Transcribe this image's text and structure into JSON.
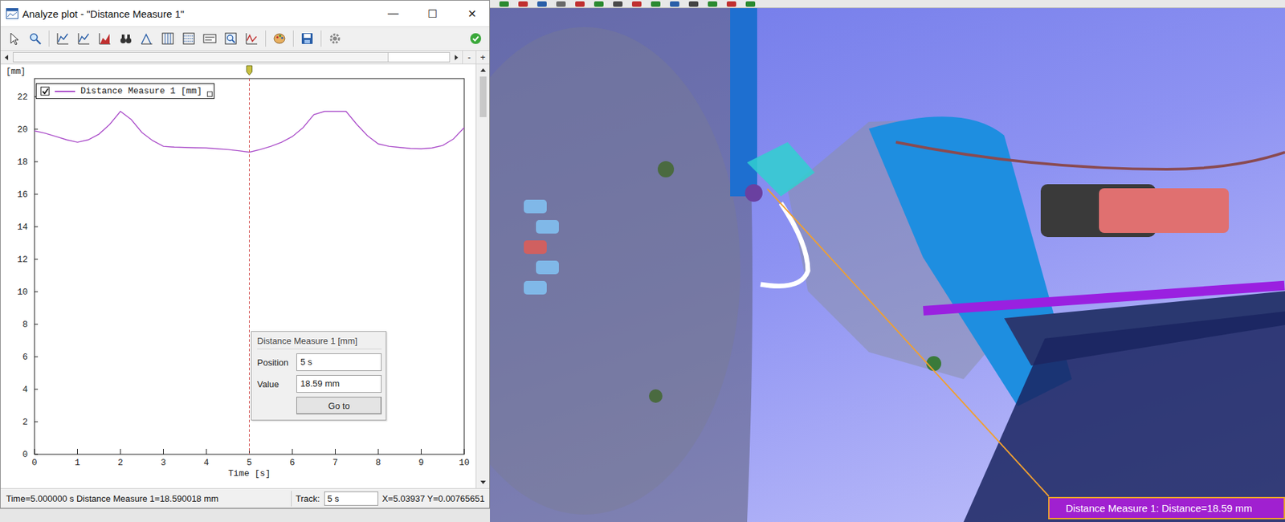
{
  "window": {
    "title": "Analyze plot - \"Distance Measure 1\"",
    "controls": [
      "—",
      "☐",
      "✕"
    ]
  },
  "scroll": {
    "zoom_out": "-",
    "zoom_in": "+"
  },
  "chart": {
    "y_unit": "[mm]",
    "y_ticks": [
      "0",
      "2",
      "4",
      "6",
      "8",
      "10",
      "12",
      "14",
      "16",
      "18",
      "20",
      "22"
    ],
    "x_ticks": [
      "0",
      "1",
      "2",
      "3",
      "4",
      "5",
      "6",
      "7",
      "8",
      "9",
      "10"
    ],
    "x_label": "Time [s]",
    "legend": {
      "label": "Distance Measure 1 [mm]",
      "checked": true
    },
    "cursor_time": 5,
    "series": [
      {
        "name": "Distance Measure 1",
        "color": "#a848c8",
        "values": [
          19.9,
          19.75,
          19.55,
          19.35,
          19.2,
          19.35,
          19.7,
          20.3,
          21.1,
          20.6,
          19.8,
          19.3,
          18.95,
          18.9,
          18.88,
          18.86,
          18.85,
          18.8,
          18.75,
          18.68,
          18.59,
          18.75,
          18.95,
          19.2,
          19.55,
          20.1,
          20.9,
          21.1,
          21.1,
          21.1,
          20.3,
          19.6,
          19.1,
          18.95,
          18.88,
          18.82,
          18.8,
          18.85,
          19.0,
          19.4,
          20.1
        ]
      }
    ]
  },
  "tooltip": {
    "title": "Distance Measure 1 [mm]",
    "position_label": "Position",
    "position_value": "5 s",
    "value_label": "Value",
    "value_value": "18.59 mm",
    "button": "Go to"
  },
  "status_bar": {
    "text": "Time=5.000000 s Distance Measure 1=18.590018 mm",
    "track_label": "Track:",
    "track_value": "5 s",
    "coords": "X=5.03937  Y=0.00765651"
  },
  "scene": {
    "label": "Distance Measure 1: Distance=18.59 mm"
  }
}
